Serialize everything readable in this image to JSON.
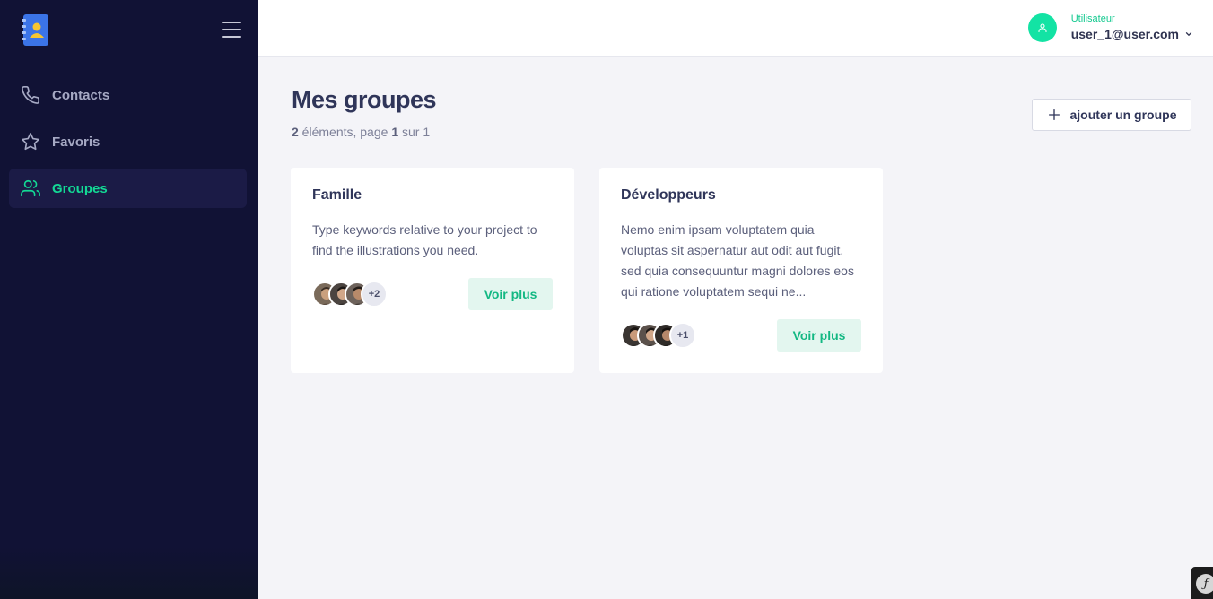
{
  "sidebar": {
    "items": [
      {
        "label": "Contacts",
        "icon": "phone-icon"
      },
      {
        "label": "Favoris",
        "icon": "star-icon"
      },
      {
        "label": "Groupes",
        "icon": "users-icon",
        "active": true
      }
    ]
  },
  "header": {
    "role": "Utilisateur",
    "email": "user_1@user.com"
  },
  "main": {
    "title": "Mes groupes",
    "count": "2",
    "count_suffix": " éléments, page ",
    "page": "1",
    "page_suffix": " sur 1",
    "add_button_label": "ajouter un groupe",
    "groups": [
      {
        "name": "Famille",
        "description": "Type keywords relative to your project to find the illustrations you need.",
        "more_count": "+2",
        "button_label": "Voir plus"
      },
      {
        "name": "Développeurs",
        "description": "Nemo enim ipsam voluptatem quia voluptas sit aspernatur aut odit aut fugit, sed quia consequuntur magni dolores eos qui ratione voluptatem sequi ne...",
        "more_count": "+1",
        "button_label": "Voir plus"
      }
    ]
  },
  "colors": {
    "sidebar_bg": "#111235",
    "accent": "#13d995",
    "title": "#2f3559"
  }
}
